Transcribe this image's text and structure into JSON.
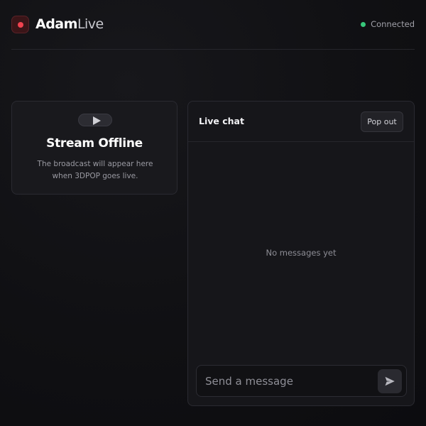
{
  "header": {
    "brand_bold": "Adam",
    "brand_light": "Live",
    "status": "Connected",
    "status_color": "#37c77a",
    "logo_icon": "record-icon"
  },
  "player": {
    "icon": "play-icon",
    "title": "Stream Offline",
    "subtitle": "The broadcast will appear here when 3DPOP goes live."
  },
  "chat": {
    "title": "Live chat",
    "popout_label": "Pop out",
    "empty_text": "No messages yet",
    "input_placeholder": "Send a message",
    "input_value": "",
    "send_icon": "send-icon"
  },
  "colors": {
    "accent": "#f0434f",
    "background": "#0f0f12"
  }
}
